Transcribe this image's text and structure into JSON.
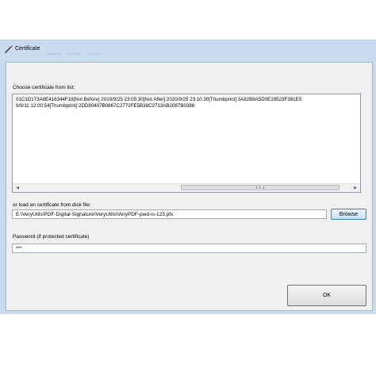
{
  "window": {
    "title": "Certificate",
    "ghost_tabs": [
      "Signature",
      "Encryption",
      "Overwrite"
    ]
  },
  "certificate_list": {
    "label": "Choose certificate from list:",
    "rows": [
      "01C1D173A8E418344F18[Not Before]  2019/9/25 23:05:30[Not After]  2020/9/25 23:10:30[Thumbprint]  3A82B8A5D0E19523F381E5",
      "9/9/11 12:00:54[Thumbprint]  2DD80407B0867C2772FE5B38C2713AB2087B0388"
    ]
  },
  "disk_file": {
    "label": "or load an certificate from disk file:",
    "value": "E:\\VeryUtils\\PDF-Digital-Signature\\VeryUtils\\VeryPDF-pwd-is-123.pfx",
    "browse_label": "Browse"
  },
  "password": {
    "label": "Password (if protected certificate)",
    "value": "***"
  },
  "ok_label": "OK"
}
